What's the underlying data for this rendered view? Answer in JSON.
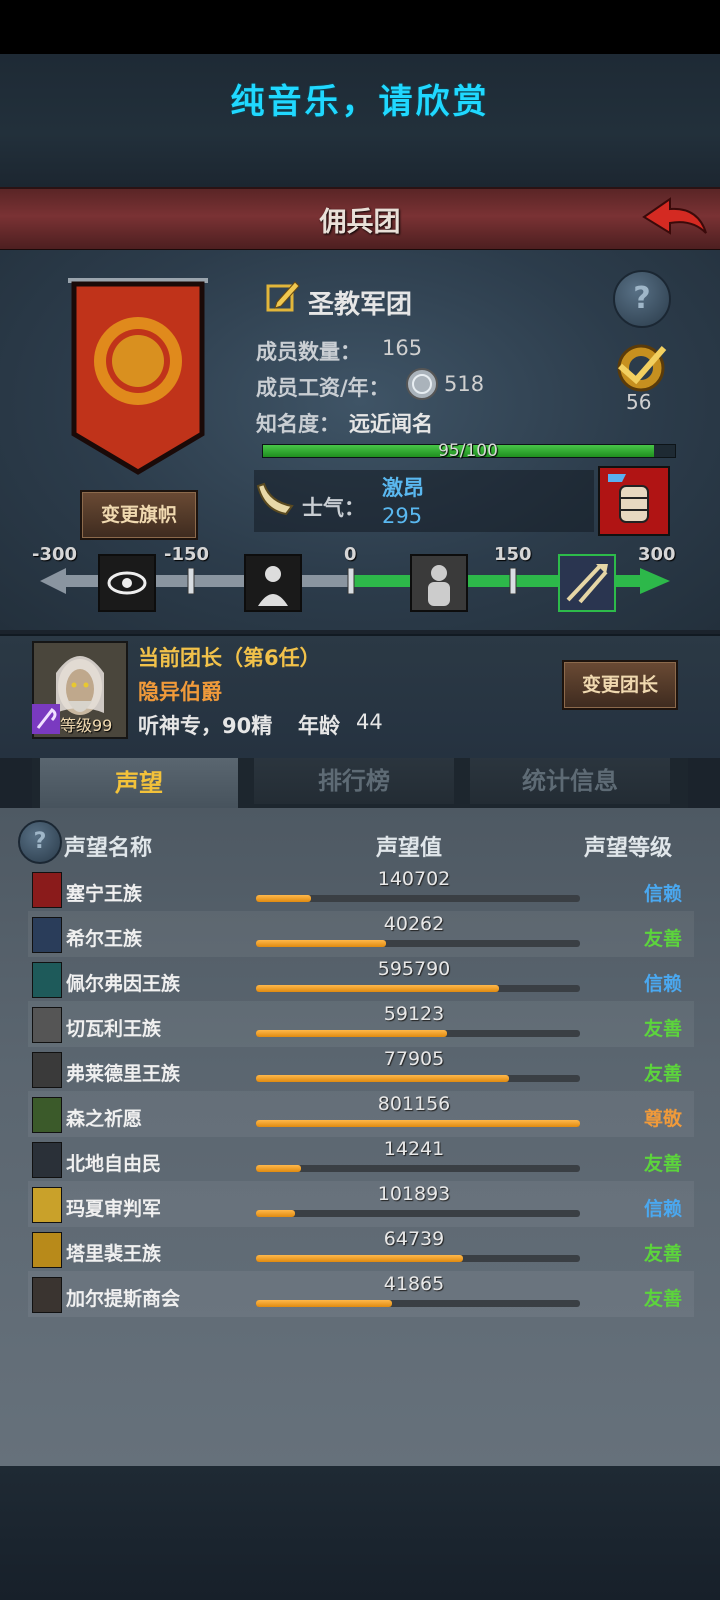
{
  "top_banner": "纯音乐，请欣赏",
  "header": {
    "title": "佣兵团",
    "back_icon": "back-arrow-icon"
  },
  "guild": {
    "name": "圣教军团",
    "members_label": "成员数量：",
    "members": "165",
    "wage_label": "成员工资/年：",
    "wage": "518",
    "fame_label": "知名度：",
    "fame_value": "远近闻名",
    "fame_progress": "95/100",
    "fame_ratio": 0.95,
    "badge_value": "56",
    "change_banner_btn": "变更旗帜"
  },
  "morale": {
    "label": "士气：",
    "state": "激昂",
    "value": "295",
    "ticks": [
      "-300",
      "-150",
      "0",
      "150",
      "300"
    ]
  },
  "leader": {
    "title": "当前团长（第6任）",
    "name": "隐异伯爵",
    "level": "等级99",
    "traits": "听神专，90精",
    "age_label": "年龄",
    "age": "44",
    "change_btn": "变更团长"
  },
  "tabs": [
    "声望",
    "排行榜",
    "统计信息"
  ],
  "table": {
    "headers": [
      "声望名称",
      "声望值",
      "声望等级"
    ],
    "rows": [
      {
        "name": "塞宁王族",
        "value": "140702",
        "ratio": 0.17,
        "level": "信赖",
        "color": "#4aa8f0",
        "icon_bg": "#8a1b1b"
      },
      {
        "name": "希尔王族",
        "value": "40262",
        "ratio": 0.4,
        "level": "友善",
        "color": "#5cd43c",
        "icon_bg": "#2a3d5a"
      },
      {
        "name": "佩尔弗因王族",
        "value": "595790",
        "ratio": 0.75,
        "level": "信赖",
        "color": "#4aa8f0",
        "icon_bg": "#1e5a5a"
      },
      {
        "name": "切瓦利王族",
        "value": "59123",
        "ratio": 0.59,
        "level": "友善",
        "color": "#5cd43c",
        "icon_bg": "#555555"
      },
      {
        "name": "弗莱德里王族",
        "value": "77905",
        "ratio": 0.78,
        "level": "友善",
        "color": "#5cd43c",
        "icon_bg": "#3a3a3a"
      },
      {
        "name": "森之祈愿",
        "value": "801156",
        "ratio": 1.0,
        "level": "尊敬",
        "color": "#f09a3a",
        "icon_bg": "#3b5a2a"
      },
      {
        "name": "北地自由民",
        "value": "14241",
        "ratio": 0.14,
        "level": "友善",
        "color": "#5cd43c",
        "icon_bg": "#2a3038"
      },
      {
        "name": "玛夏审判军",
        "value": "101893",
        "ratio": 0.12,
        "level": "信赖",
        "color": "#4aa8f0",
        "icon_bg": "#c9a12a"
      },
      {
        "name": "塔里裴王族",
        "value": "64739",
        "ratio": 0.64,
        "level": "友善",
        "color": "#5cd43c",
        "icon_bg": "#b88a1a"
      },
      {
        "name": "加尔提斯商会",
        "value": "41865",
        "ratio": 0.42,
        "level": "友善",
        "color": "#5cd43c",
        "icon_bg": "#3a3430"
      }
    ]
  }
}
